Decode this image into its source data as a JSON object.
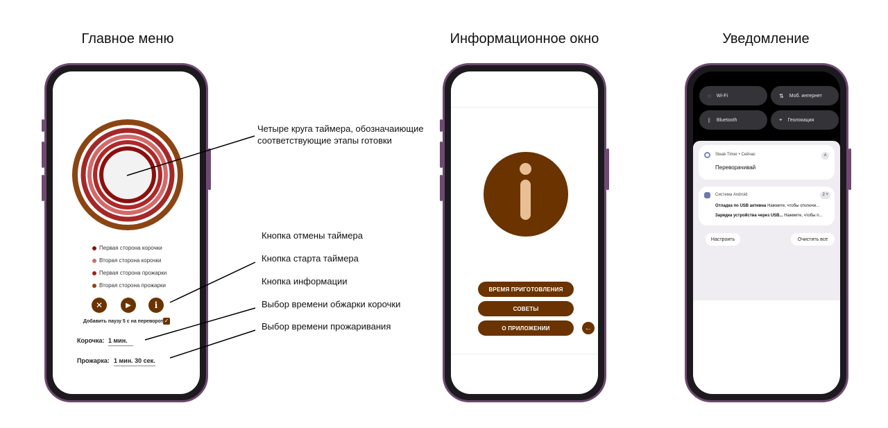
{
  "titles": {
    "main_menu": "Главное меню",
    "info_window": "Информационное окно",
    "notification": "Уведомление"
  },
  "annotations": {
    "circles": "Четыре круга таймера, обозначаиющие соответствующие этапы готовки",
    "cancel": "Кнопка отмены таймера",
    "start": "Кнопка старта таймера",
    "info": "Кнопка информации",
    "crust_time": "Выбор времени обжарки корочки",
    "roast_time": "Выбор времени прожаривания"
  },
  "timer_screen": {
    "legend": [
      {
        "label": "Первая сторона корочки",
        "color": "#8b1010"
      },
      {
        "label": "Вторая сторона корочки",
        "color": "#d26a6a"
      },
      {
        "label": "Первая сторона прожарки",
        "color": "#a52020"
      },
      {
        "label": "Вторая сторона прожарки",
        "color": "#8b4513"
      }
    ],
    "ring_colors": {
      "outer": "#8b4513",
      "ring2": "#a52828",
      "ring3": "#d26a6a",
      "ring4": "#b02828",
      "inner": "#8b1010"
    },
    "pause_label": "Добавить паузу 5 с на переворот",
    "crust_label": "Корочка:",
    "crust_value": "1 мин.",
    "roast_label": "Прожарка:",
    "roast_value": "1 мин. 30 сек.",
    "accent": "#6a3300"
  },
  "info_screen": {
    "buttons": [
      "ВРЕМЯ ПРИГОТОВЛЕНИЯ",
      "СОВЕТЫ",
      "О ПРИЛОЖЕНИИ"
    ],
    "icon_color": "#6a3300"
  },
  "notification_screen": {
    "tiles": [
      "Wi-Fi",
      "Моб. интернет",
      "Bluetooth",
      "Геолокация"
    ],
    "steak": {
      "app": "Steak Timer • Сейчас",
      "message": "Переворачивай"
    },
    "android": {
      "app": "Система Android",
      "count": "2",
      "line1_title": "Отладка по USB активна",
      "line1_text": "Нажмите, чтобы отключи...",
      "line2_title": "Зарядка устройства через USB...",
      "line2_text": "Нажмите, чтобы п..."
    },
    "settings_button": "Настроить",
    "clear_button": "Очистить все"
  }
}
